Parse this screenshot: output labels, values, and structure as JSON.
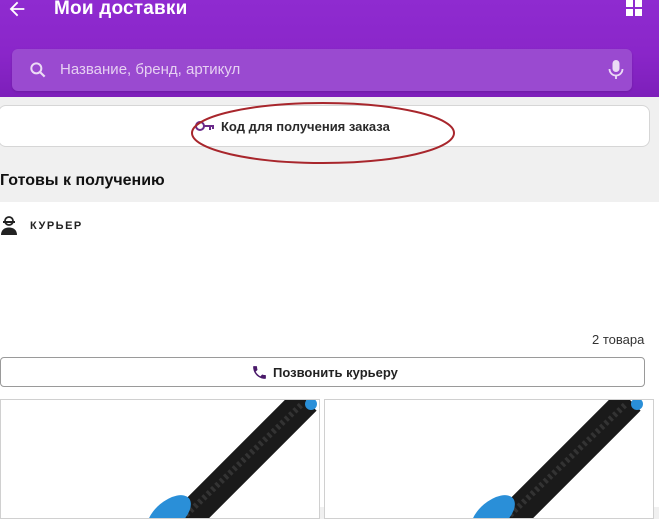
{
  "header": {
    "title": "Мои доставки",
    "back_icon": "arrow-left-icon",
    "menu_icon": "grid-icon",
    "background": "#8a26c9"
  },
  "search": {
    "placeholder": "Название, бренд, артикул",
    "icon": "search-icon",
    "mic_icon": "microphone-icon"
  },
  "order_code_button": {
    "label": "Код для получения заказа",
    "icon": "key-icon",
    "highlight_color": "#a8262c"
  },
  "section": {
    "title": "Готовы к получению"
  },
  "delivery": {
    "method_label": "КУРЬЕР",
    "method_icon": "courier-icon",
    "items_count": "2 товара",
    "call_button_label": "Позвонить курьеру",
    "call_icon": "phone-icon"
  },
  "products": [
    {
      "image": "cable-product-image"
    },
    {
      "image": "cable-product-image"
    }
  ]
}
